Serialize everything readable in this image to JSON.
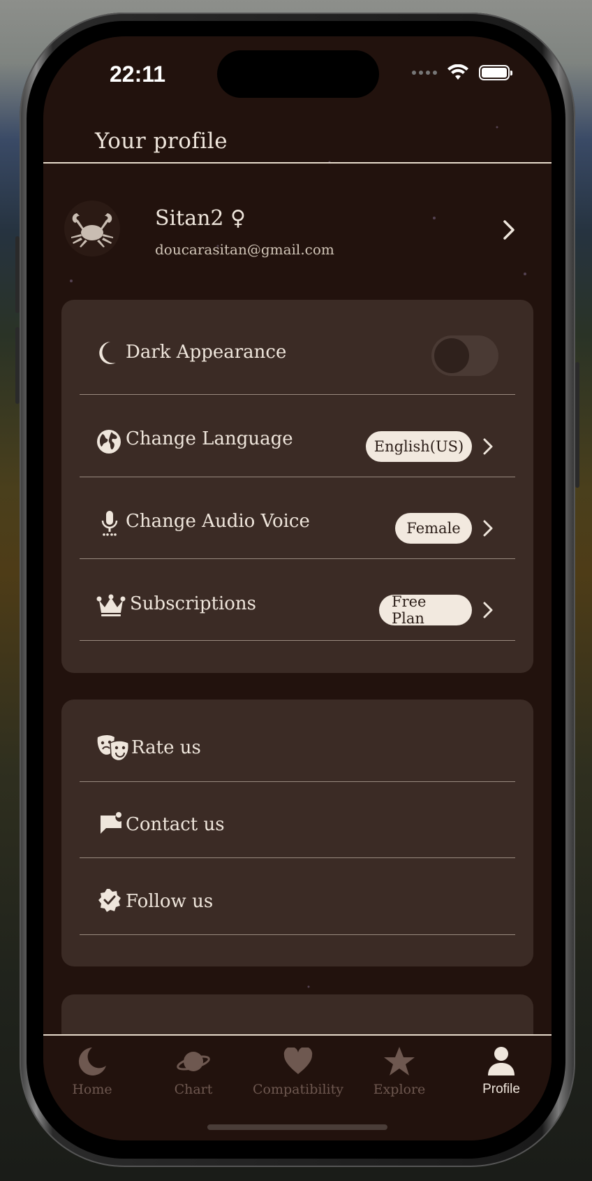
{
  "status_bar": {
    "time": "22:11"
  },
  "header": {
    "title": "Your profile"
  },
  "profile": {
    "name": "Sitan2 ♀",
    "email": "doucarasitan@gmail.com"
  },
  "settings": {
    "dark_appearance": {
      "label": "Dark Appearance",
      "enabled": false
    },
    "language": {
      "label": "Change Language",
      "value": "English(US)"
    },
    "audio_voice": {
      "label": "Change Audio Voice",
      "value": "Female"
    },
    "subscriptions": {
      "label": "Subscriptions",
      "value": "Free Plan"
    }
  },
  "social": {
    "rate": {
      "label": "Rate us"
    },
    "contact": {
      "label": "Contact us"
    },
    "follow": {
      "label": "Follow us"
    }
  },
  "tabbar": {
    "tabs": [
      {
        "label": "Home",
        "icon": "moon-icon"
      },
      {
        "label": "Chart",
        "icon": "planet-icon"
      },
      {
        "label": "Compatibility",
        "icon": "heart-icon"
      },
      {
        "label": "Explore",
        "icon": "star-icon"
      },
      {
        "label": "Profile",
        "icon": "person-icon",
        "active": true
      }
    ]
  },
  "colors": {
    "background": "#22120d",
    "card": "#3b2b25",
    "text": "#efe6dc",
    "inactive_tab": "#6e5850",
    "pill": "#f2e9df"
  }
}
